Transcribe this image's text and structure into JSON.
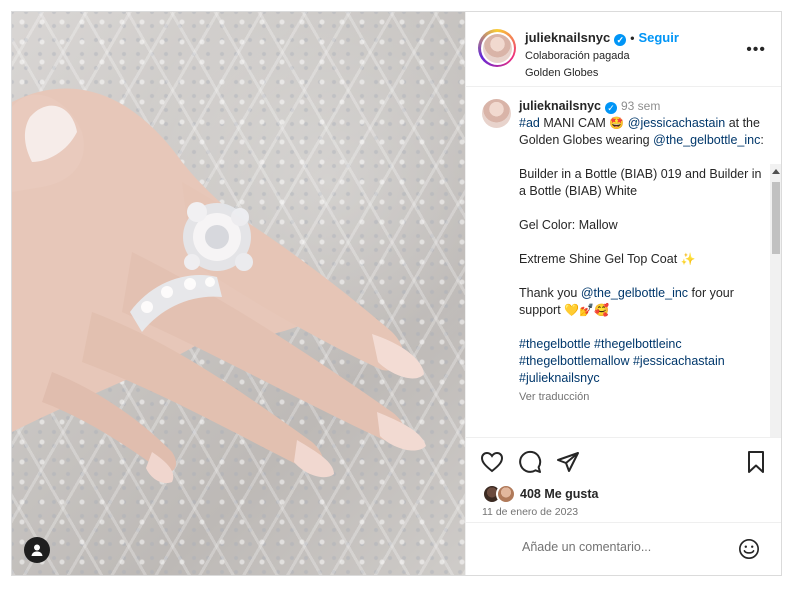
{
  "post": {
    "username": "julieknailsnyc",
    "verified_icon": "check-badge-icon",
    "separator": "•",
    "follow_label": "Seguir",
    "paid_partnership": "Colaboración pagada",
    "location": "Golden Globes",
    "more_icon": "•••"
  },
  "caption": {
    "username": "julieknailsnyc",
    "time": "93 sem",
    "line1_tag": "#ad",
    "line1_text": " MANI CAM ",
    "line1_emoji": "🤩",
    "mention1": "@jessicachastain",
    "line1_rest": " at the Golden Globes wearing",
    "mention2": "@the_gelbottle_inc",
    "mention2_colon": ":",
    "line2": "Builder in a Bottle (BIAB) 019 and Builder in a Bottle (BIAB) White",
    "line3": "Gel Color: Mallow",
    "line4": "Extreme Shine Gel Top Coat ",
    "line4_emoji": "✨",
    "line5_pre": "Thank you ",
    "mention3": "@the_gelbottle_inc",
    "line5_post": " for your support ",
    "line5_emoji": "💛💅🥰",
    "hashtags": "#thegelbottle #thegelbottleinc #thegelbottlemallow #jessicachastain #julieknailsnyc",
    "see_translation": "Ver traducción"
  },
  "actions": {
    "like_icon": "heart-icon",
    "comment_icon": "comment-icon",
    "share_icon": "paper-plane-icon",
    "save_icon": "bookmark-icon",
    "likes": "408 Me gusta",
    "date": "11 de enero de 2023"
  },
  "comment": {
    "placeholder": "Añade un comentario...",
    "emoji_icon": "smiley-icon"
  },
  "colors": {
    "accent": "#0095f6",
    "link": "#00376b",
    "muted": "#737373"
  }
}
